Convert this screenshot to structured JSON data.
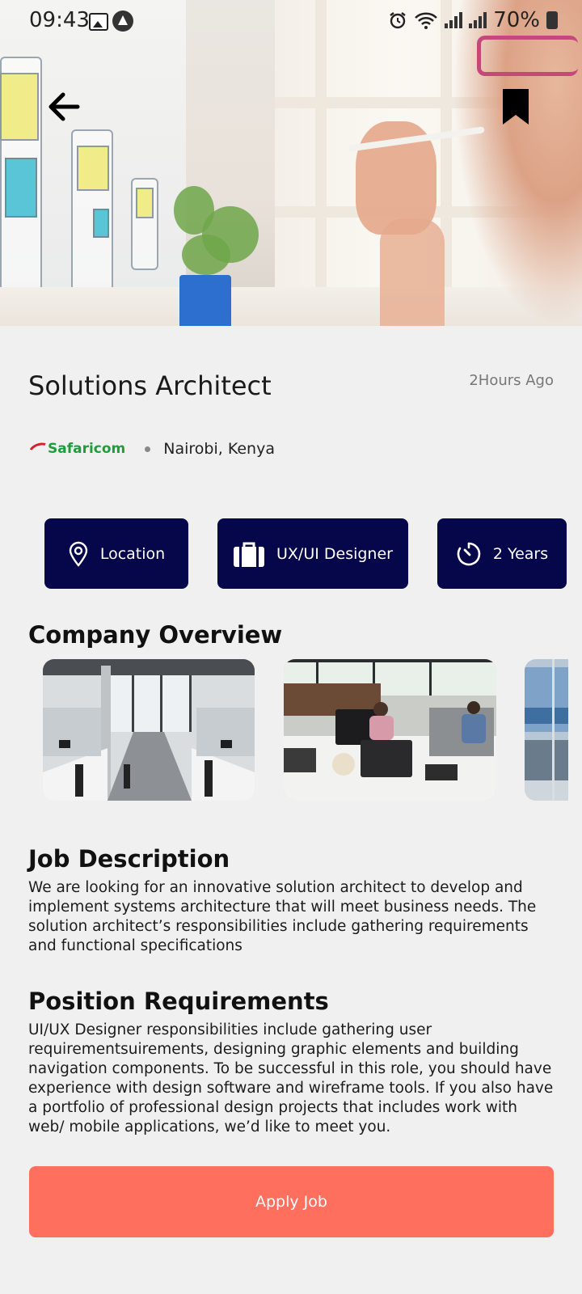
{
  "status_bar": {
    "time": "09:43",
    "battery": "70%"
  },
  "hero": {
    "back_icon": "arrow-left-icon",
    "bookmark_icon": "bookmark-icon"
  },
  "job": {
    "title": "Solutions Architect",
    "posted": "2Hours Ago",
    "company_logo_text": "Safaricom",
    "location": "Nairobi, Kenya"
  },
  "chips": [
    {
      "label": "Location",
      "icon": "map-pin-icon"
    },
    {
      "label": "UX/UI Designer",
      "icon": "briefcase-icon"
    },
    {
      "label": "2 Years",
      "icon": "timer-icon"
    }
  ],
  "company_overview": {
    "title": "Company Overview"
  },
  "job_description": {
    "title": "Job Description",
    "text": "We are looking for an innovative solution architect to develop and implement systems architecture that will meet business needs. The solution architect’s responsibilities include gathering requirements and functional specifications"
  },
  "position_requirements": {
    "title": "Position Requirements",
    "text": "UI/UX Designer responsibilities include gathering user requirementsuirements, designing graphic elements and building navigation components. To be successful in this role, you should have experience with design software and wireframe tools. If you also have a portfolio of professional design projects that includes work with web/ mobile applications, we’d like to meet you."
  },
  "apply_button": {
    "label": "Apply Job"
  },
  "colors": {
    "chip_bg": "#06064a",
    "apply_bg": "#fe6f5e",
    "background": "#f1f0f1"
  }
}
